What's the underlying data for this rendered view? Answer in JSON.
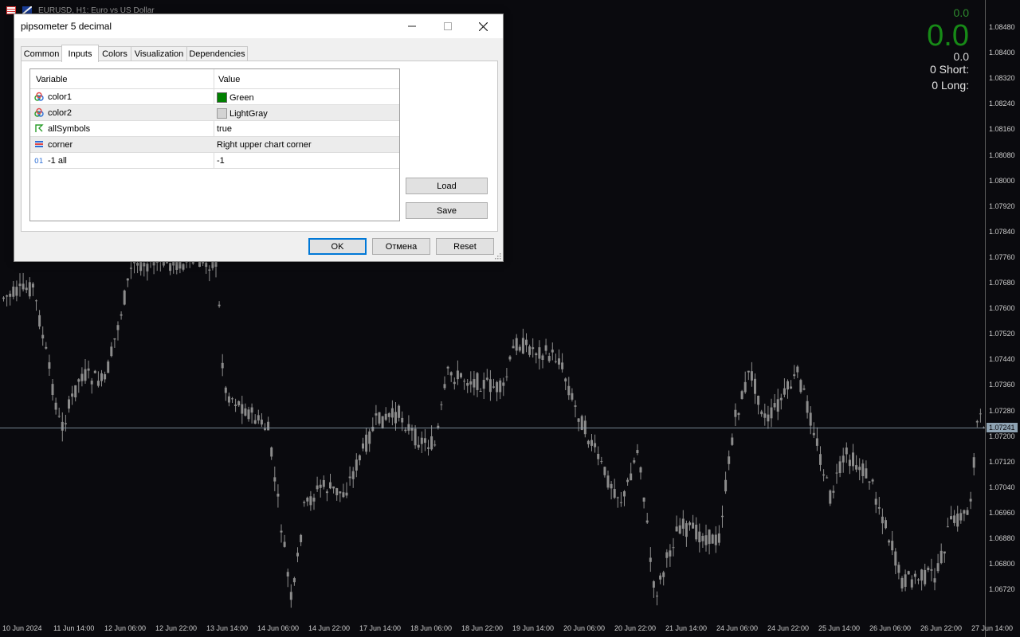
{
  "chart": {
    "title": "EURUSD, H1:  Euro vs US Dollar",
    "current_price": "1.07241",
    "price_ticks": [
      "1.08480",
      "1.08400",
      "1.08320",
      "1.08240",
      "1.08160",
      "1.08080",
      "1.08000",
      "1.07920",
      "1.07840",
      "1.07760",
      "1.07680",
      "1.07600",
      "1.07520",
      "1.07440",
      "1.07360",
      "1.07280",
      "1.07200",
      "1.07120",
      "1.07040",
      "1.06960",
      "1.06880",
      "1.06800",
      "1.06720"
    ],
    "time_ticks": [
      "10 Jun 2024",
      "11 Jun 14:00",
      "12 Jun 06:00",
      "12 Jun 22:00",
      "13 Jun 14:00",
      "14 Jun 06:00",
      "14 Jun 22:00",
      "17 Jun 14:00",
      "18 Jun 06:00",
      "18 Jun 22:00",
      "19 Jun 14:00",
      "20 Jun 06:00",
      "20 Jun 22:00",
      "21 Jun 14:00",
      "24 Jun 06:00",
      "24 Jun 22:00",
      "25 Jun 14:00",
      "26 Jun 06:00",
      "26 Jun 22:00",
      "27 Jun 14:00"
    ],
    "candle_color": "#8c8c8c",
    "background": "#0a0a0e"
  },
  "pipsometer": {
    "top_value": "0.0",
    "big_value": "0.0",
    "grey_value": "0.0",
    "short_label": "0  Short:",
    "long_label": "0  Long:",
    "color_green": "#178a17"
  },
  "dialog": {
    "title": "pipsometer 5 decimal",
    "tabs": [
      {
        "label": "Common"
      },
      {
        "label": "Inputs"
      },
      {
        "label": "Colors"
      },
      {
        "label": "Visualization"
      },
      {
        "label": "Dependencies"
      }
    ],
    "active_tab": "Inputs",
    "grid": {
      "col_variable": "Variable",
      "col_value": "Value",
      "rows": [
        {
          "name": "color1",
          "value": "Green",
          "icon": "color-icon",
          "swatch": "#008000"
        },
        {
          "name": "color2",
          "value": "LightGray",
          "icon": "color-icon",
          "swatch": "#d3d3d3"
        },
        {
          "name": "allSymbols",
          "value": "true",
          "icon": "bool-icon"
        },
        {
          "name": "corner",
          "value": "Right upper chart corner",
          "icon": "enum-icon"
        },
        {
          "name": "-1 all",
          "value": "-1",
          "icon": "integer-icon"
        }
      ]
    },
    "buttons": {
      "load": "Load",
      "save": "Save",
      "ok": "OK",
      "cancel": "Отмена",
      "reset": "Reset"
    }
  }
}
